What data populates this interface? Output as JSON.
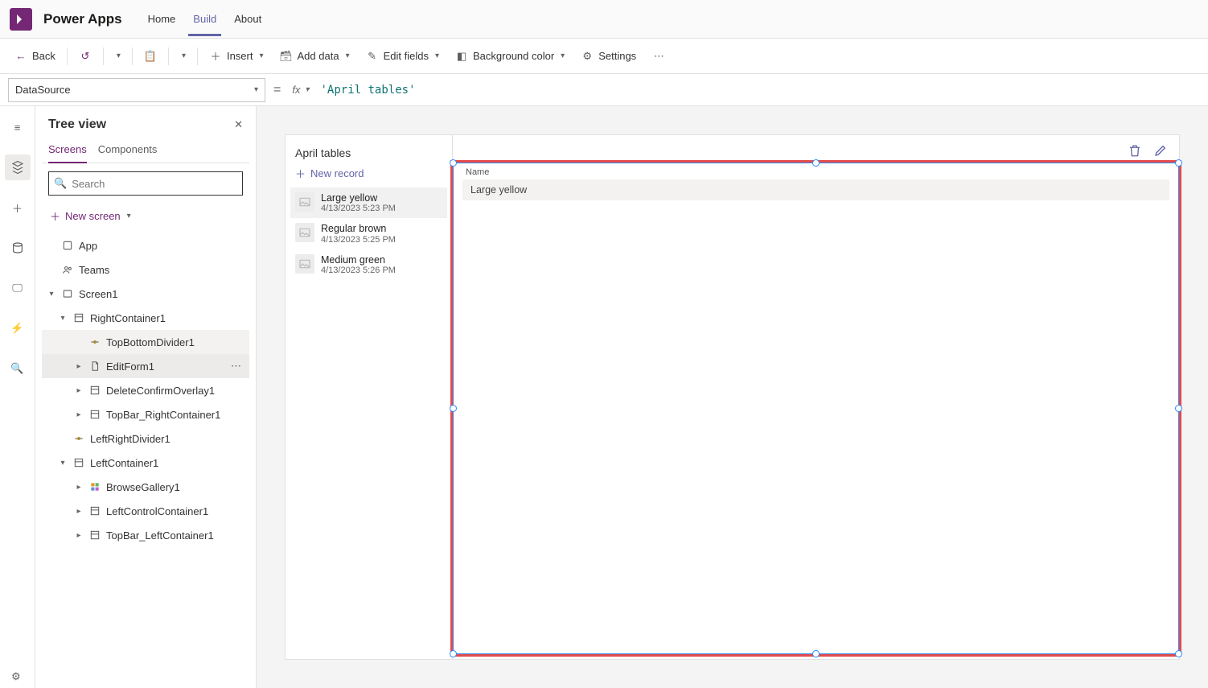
{
  "header": {
    "app_title": "Power Apps",
    "tabs": [
      "Home",
      "Build",
      "About"
    ],
    "active_tab": "Build"
  },
  "commandbar": {
    "back": "Back",
    "insert": "Insert",
    "add_data": "Add data",
    "edit_fields": "Edit fields",
    "background_color": "Background color",
    "settings": "Settings"
  },
  "formula": {
    "property": "DataSource",
    "value": "'April tables'"
  },
  "treeview": {
    "title": "Tree view",
    "tabs": {
      "screens": "Screens",
      "components": "Components",
      "active": "Screens"
    },
    "search_placeholder": "Search",
    "new_screen": "New screen",
    "items": [
      {
        "label": "App",
        "indent": 0,
        "icon": "app",
        "chev": ""
      },
      {
        "label": "Teams",
        "indent": 0,
        "icon": "teams",
        "chev": ""
      },
      {
        "label": "Screen1",
        "indent": 0,
        "icon": "screen",
        "chev": "down"
      },
      {
        "label": "RightContainer1",
        "indent": 1,
        "icon": "container",
        "chev": "down"
      },
      {
        "label": "TopBottomDivider1",
        "indent": 2,
        "icon": "divider",
        "chev": "",
        "highlighted": true
      },
      {
        "label": "EditForm1",
        "indent": 2,
        "icon": "form",
        "chev": "right",
        "selected": true,
        "ellipsis": true
      },
      {
        "label": "DeleteConfirmOverlay1",
        "indent": 2,
        "icon": "container",
        "chev": "right"
      },
      {
        "label": "TopBar_RightContainer1",
        "indent": 2,
        "icon": "container",
        "chev": "right"
      },
      {
        "label": "LeftRightDivider1",
        "indent": 1,
        "icon": "divider",
        "chev": ""
      },
      {
        "label": "LeftContainer1",
        "indent": 1,
        "icon": "container",
        "chev": "down"
      },
      {
        "label": "BrowseGallery1",
        "indent": 2,
        "icon": "gallery",
        "chev": "right"
      },
      {
        "label": "LeftControlContainer1",
        "indent": 2,
        "icon": "container",
        "chev": "right"
      },
      {
        "label": "TopBar_LeftContainer1",
        "indent": 2,
        "icon": "container",
        "chev": "right"
      }
    ]
  },
  "app_preview": {
    "title": "April tables",
    "new_record": "New record",
    "records": [
      {
        "title": "Large yellow",
        "time": "4/13/2023 5:23 PM",
        "active": true
      },
      {
        "title": "Regular brown",
        "time": "4/13/2023 5:25 PM"
      },
      {
        "title": "Medium green",
        "time": "4/13/2023 5:26 PM"
      }
    ],
    "form": {
      "label": "Name",
      "value": "Large yellow"
    }
  }
}
